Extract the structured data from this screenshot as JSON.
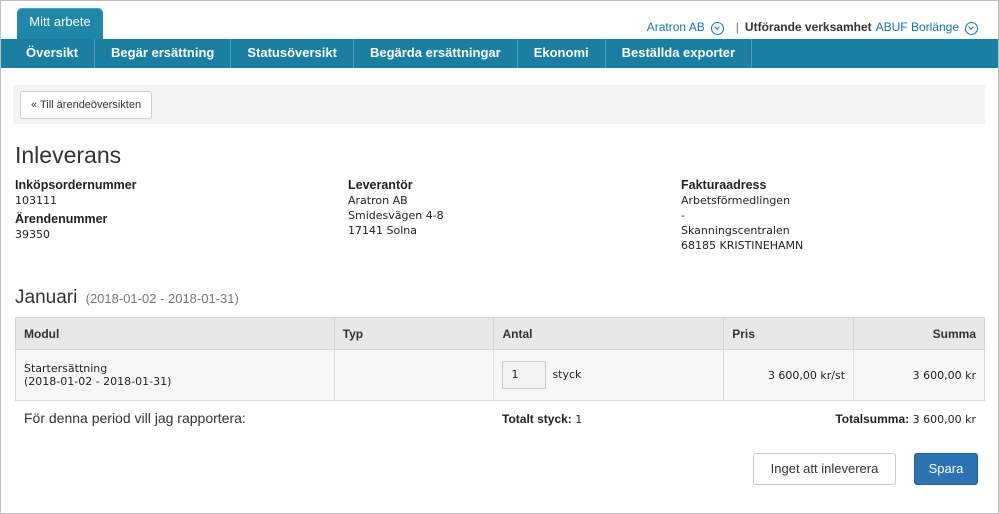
{
  "header": {
    "app_tab": "Mitt arbete",
    "account": "Aratron AB",
    "org_label": "Utförande verksamhet",
    "org_value": "ABUF Borlänge"
  },
  "nav": [
    "Översikt",
    "Begär ersättning",
    "Statusöversikt",
    "Begärda ersättningar",
    "Ekonomi",
    "Beställda exporter"
  ],
  "breadcrumb": {
    "back_label": "« Till ärendeöversikten"
  },
  "page": {
    "title": "Inleverans"
  },
  "details": {
    "order_label": "Inköpsordernummer",
    "order_value": "103111",
    "case_label": "Ärendenummer",
    "case_value": "39350",
    "supplier_label": "Leverantör",
    "supplier_lines": [
      "Aratron AB",
      "Smidesvägen 4-8",
      "17141 Solna"
    ],
    "invoice_label": "Fakturaadress",
    "invoice_lines": [
      "Arbetsförmedlingen",
      "-",
      "Skanningscentralen",
      "68185 KRISTINEHAMN"
    ]
  },
  "period": {
    "title": "Januari",
    "range": "(2018-01-02 - 2018-01-31)"
  },
  "table": {
    "headers": [
      "Modul",
      "Typ",
      "Antal",
      "Pris",
      "Summa"
    ],
    "rows": [
      {
        "module_name": "Startersättning",
        "module_period": "(2018-01-02 - 2018-01-31)",
        "type": "",
        "quantity": "1",
        "unit": "styck",
        "price": "3 600,00 kr/st",
        "sum": "3 600,00 kr"
      }
    ]
  },
  "summary": {
    "report_text": "För denna period vill jag rapportera:",
    "total_count_label": "Totalt styck:",
    "total_count_value": "1",
    "total_sum_label": "Totalsumma:",
    "total_sum_value": "3 600,00 kr"
  },
  "actions": {
    "nothing_label": "Inget att inleverera",
    "save_label": "Spara"
  },
  "colors": {
    "nav_bg": "#1a7fa2",
    "primary_button": "#2d73b4",
    "link": "#1a73a8"
  }
}
